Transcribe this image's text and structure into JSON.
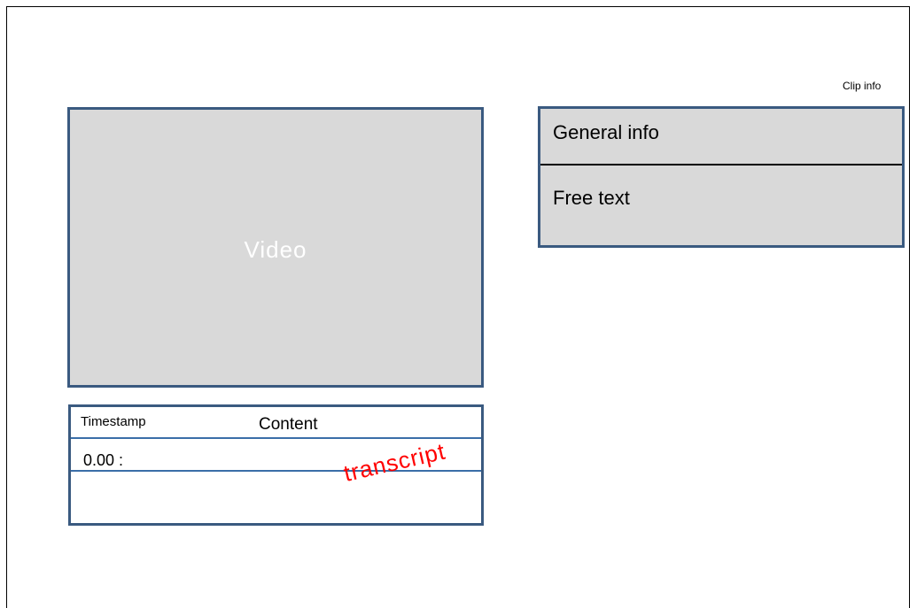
{
  "clip_info_label": "Clip info",
  "video": {
    "label": "Video"
  },
  "info_panel": {
    "general_label": "General info",
    "free_text_label": "Free text"
  },
  "transcript": {
    "timestamp_header": "Timestamp",
    "content_header": "Content",
    "first_timestamp": "0.00 :",
    "overlay_word": "transcript"
  },
  "colors": {
    "panel_fill": "#d9d9d9",
    "panel_border": "#3a5a80",
    "row_line": "#3a6ea8",
    "annotation_red": "#ff0000"
  }
}
